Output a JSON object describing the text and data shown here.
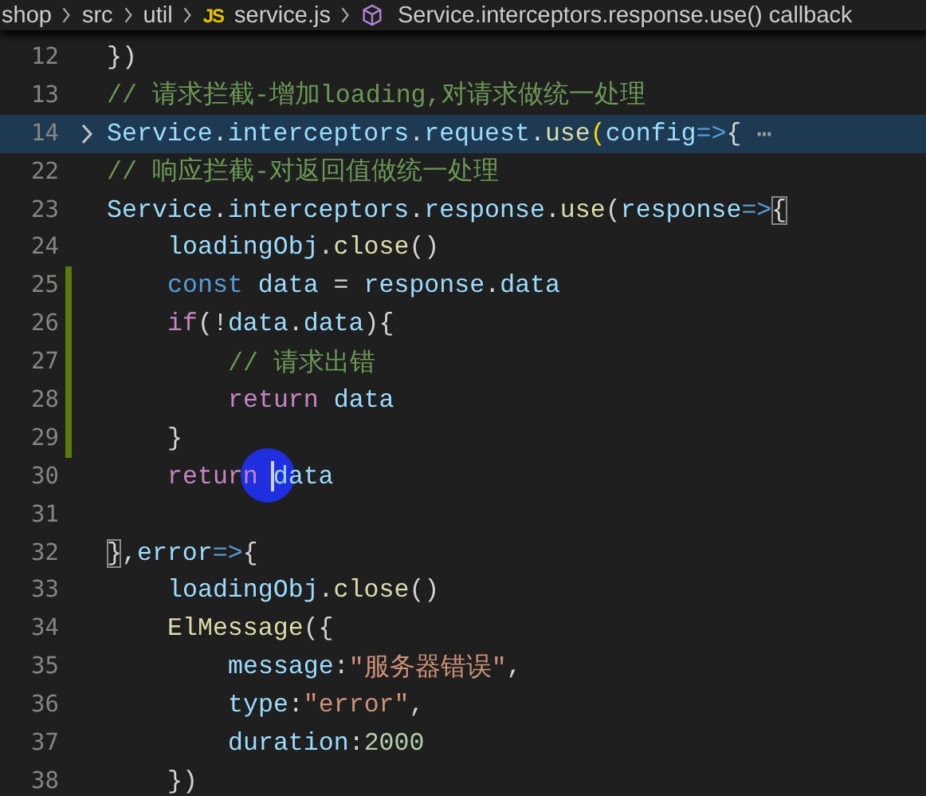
{
  "breadcrumb": [
    {
      "kind": "folder",
      "label": "shop"
    },
    {
      "kind": "folder",
      "label": "src"
    },
    {
      "kind": "folder",
      "label": "util"
    },
    {
      "kind": "jsfile",
      "icon_text": "JS",
      "label": "service.js"
    },
    {
      "kind": "symbol",
      "label": "Service.interceptors.response.use() callback"
    }
  ],
  "lines": [
    {
      "number": "12",
      "kind": "flush",
      "folded": false,
      "highlighted": false,
      "modified": false,
      "tokens": [
        {
          "kind": "punct",
          "text": "})"
        }
      ]
    },
    {
      "number": "13",
      "kind": "flush",
      "folded": false,
      "highlighted": false,
      "modified": false,
      "tokens": [
        {
          "kind": "comment",
          "text": "// 请求拦截-增加loading,对请求做统一处理"
        }
      ]
    },
    {
      "number": "14",
      "kind": "flush",
      "folded": true,
      "highlighted": true,
      "modified": false,
      "tokens": [
        {
          "kind": "var",
          "text": "Service"
        },
        {
          "kind": "punct",
          "text": "."
        },
        {
          "kind": "var",
          "text": "interceptors"
        },
        {
          "kind": "punct",
          "text": "."
        },
        {
          "kind": "var",
          "text": "request"
        },
        {
          "kind": "punct",
          "text": "."
        },
        {
          "kind": "func",
          "text": "use"
        },
        {
          "kind": "bracket",
          "text": "("
        },
        {
          "kind": "var",
          "text": "config"
        },
        {
          "kind": "storage",
          "text": "=>"
        },
        {
          "kind": "punct",
          "text": "{"
        },
        {
          "kind": "ellipsis",
          "text": " ⋯"
        }
      ]
    },
    {
      "number": "22",
      "kind": "flush",
      "folded": false,
      "highlighted": false,
      "modified": false,
      "tokens": [
        {
          "kind": "comment",
          "text": "// 响应拦截-对返回值做统一处理"
        }
      ]
    },
    {
      "number": "23",
      "kind": "flush",
      "folded": false,
      "highlighted": false,
      "modified": false,
      "tokens": [
        {
          "kind": "var",
          "text": "Service"
        },
        {
          "kind": "punct",
          "text": "."
        },
        {
          "kind": "var",
          "text": "interceptors"
        },
        {
          "kind": "punct",
          "text": "."
        },
        {
          "kind": "var",
          "text": "response"
        },
        {
          "kind": "punct",
          "text": "."
        },
        {
          "kind": "func",
          "text": "use"
        },
        {
          "kind": "punct",
          "text": "("
        },
        {
          "kind": "var",
          "text": "response"
        },
        {
          "kind": "storage",
          "text": "=>"
        },
        {
          "kind": "match",
          "text": "{"
        }
      ]
    },
    {
      "number": "24",
      "kind": "inner",
      "folded": false,
      "highlighted": false,
      "modified": false,
      "tokens": [
        {
          "kind": "var",
          "text": "loadingObj"
        },
        {
          "kind": "punct",
          "text": "."
        },
        {
          "kind": "func",
          "text": "close"
        },
        {
          "kind": "punct",
          "text": "()"
        }
      ]
    },
    {
      "number": "25",
      "kind": "inner",
      "folded": false,
      "highlighted": false,
      "modified": true,
      "tokens": [
        {
          "kind": "storage",
          "text": "const"
        },
        {
          "kind": "var",
          "text": " data"
        },
        {
          "kind": "punct",
          "text": " = "
        },
        {
          "kind": "var",
          "text": "response"
        },
        {
          "kind": "punct",
          "text": "."
        },
        {
          "kind": "var",
          "text": "data"
        }
      ]
    },
    {
      "number": "26",
      "kind": "inner",
      "folded": false,
      "highlighted": false,
      "modified": true,
      "tokens": [
        {
          "kind": "keyword",
          "text": "if"
        },
        {
          "kind": "punct",
          "text": "(!"
        },
        {
          "kind": "var",
          "text": "data"
        },
        {
          "kind": "punct",
          "text": "."
        },
        {
          "kind": "var",
          "text": "data"
        },
        {
          "kind": "punct",
          "text": "){"
        }
      ]
    },
    {
      "number": "27",
      "kind": "deep",
      "folded": false,
      "highlighted": false,
      "modified": true,
      "tokens": [
        {
          "kind": "comment",
          "text": "// 请求出错"
        }
      ]
    },
    {
      "number": "28",
      "kind": "deep",
      "folded": false,
      "highlighted": false,
      "modified": true,
      "tokens": [
        {
          "kind": "keyword",
          "text": "return"
        },
        {
          "kind": "var",
          "text": " data"
        }
      ]
    },
    {
      "number": "29",
      "kind": "inner",
      "folded": false,
      "highlighted": false,
      "modified": true,
      "tokens": [
        {
          "kind": "punct",
          "text": "}"
        }
      ]
    },
    {
      "number": "30",
      "kind": "inner",
      "folded": false,
      "highlighted": false,
      "modified": false,
      "tokens": [
        {
          "kind": "keyword",
          "text": "return "
        },
        {
          "kind": "caret"
        },
        {
          "kind": "var",
          "text": "data"
        }
      ]
    },
    {
      "number": "31",
      "kind": "flush",
      "folded": false,
      "highlighted": false,
      "modified": false
    },
    {
      "number": "32",
      "kind": "flush",
      "folded": false,
      "highlighted": false,
      "modified": false,
      "tokens": [
        {
          "kind": "match",
          "text": "}"
        },
        {
          "kind": "punct",
          "text": ","
        },
        {
          "kind": "var",
          "text": "error"
        },
        {
          "kind": "storage",
          "text": "=>"
        },
        {
          "kind": "punct",
          "text": "{"
        }
      ]
    },
    {
      "number": "33",
      "kind": "inner",
      "folded": false,
      "highlighted": false,
      "modified": false,
      "tokens": [
        {
          "kind": "var",
          "text": "loadingObj"
        },
        {
          "kind": "punct",
          "text": "."
        },
        {
          "kind": "func",
          "text": "close"
        },
        {
          "kind": "punct",
          "text": "()"
        }
      ]
    },
    {
      "number": "34",
      "kind": "inner",
      "folded": false,
      "highlighted": false,
      "modified": false,
      "tokens": [
        {
          "kind": "func",
          "text": "ElMessage"
        },
        {
          "kind": "punct",
          "text": "({"
        }
      ]
    },
    {
      "number": "35",
      "kind": "deep",
      "folded": false,
      "highlighted": false,
      "modified": false,
      "tokens": [
        {
          "kind": "var",
          "text": "message"
        },
        {
          "kind": "punct",
          "text": ":"
        },
        {
          "kind": "string",
          "text": "\"服务器错误\""
        },
        {
          "kind": "punct",
          "text": ","
        }
      ]
    },
    {
      "number": "36",
      "kind": "deep",
      "folded": false,
      "highlighted": false,
      "modified": false,
      "tokens": [
        {
          "kind": "var",
          "text": "type"
        },
        {
          "kind": "punct",
          "text": ":"
        },
        {
          "kind": "string",
          "text": "\"error\""
        },
        {
          "kind": "punct",
          "text": ","
        }
      ]
    },
    {
      "number": "37",
      "kind": "deep",
      "folded": false,
      "highlighted": false,
      "modified": false,
      "tokens": [
        {
          "kind": "var",
          "text": "duration"
        },
        {
          "kind": "punct",
          "text": ":"
        },
        {
          "kind": "number",
          "text": "2000"
        }
      ]
    },
    {
      "number": "38",
      "kind": "inner",
      "folded": false,
      "highlighted": false,
      "modified": false,
      "tokens": [
        {
          "kind": "punct",
          "text": "})"
        }
      ]
    }
  ]
}
